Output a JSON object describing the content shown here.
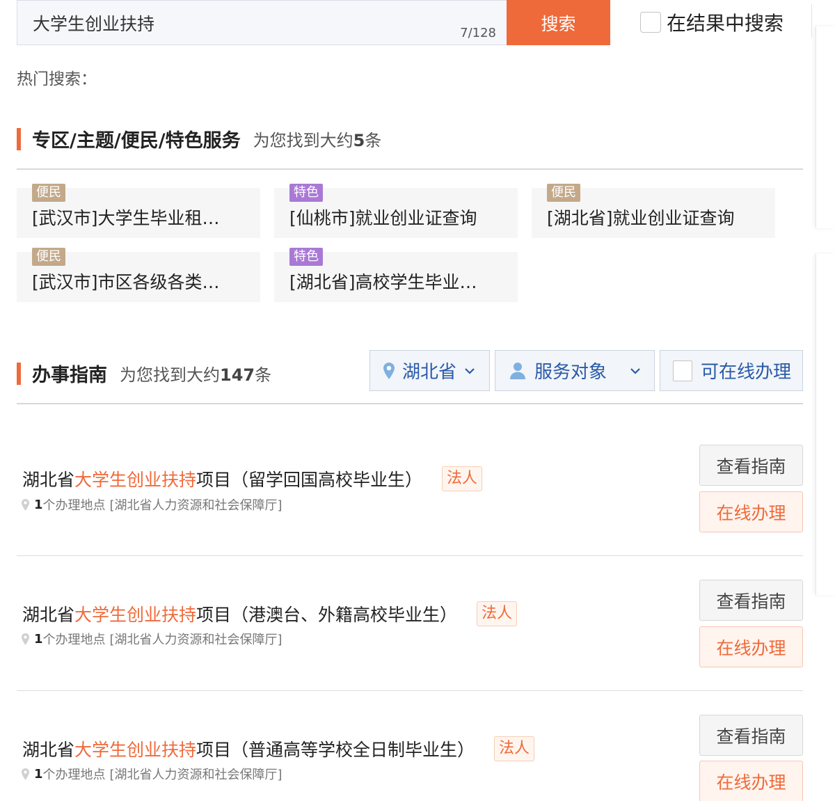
{
  "search": {
    "query": "大学生创业扶持",
    "count": "7/128",
    "button_label": "搜索",
    "in_results_label": "在结果中搜索"
  },
  "hot_search_label": "热门搜索：",
  "services_section": {
    "title": "专区/主题/便民/特色服务",
    "found_prefix": "为您找到大约",
    "found_count": "5",
    "found_suffix": "条",
    "items": [
      {
        "tag": "便民",
        "text": "[武汉市]大学生毕业租…"
      },
      {
        "tag": "特色",
        "text": "[仙桃市]就业创业证查询"
      },
      {
        "tag": "便民",
        "text": "[湖北省]就业创业证查询"
      },
      {
        "tag": "便民",
        "text": "[武汉市]市区各级各类…"
      },
      {
        "tag": "特色",
        "text": "[湖北省]高校学生毕业…"
      }
    ]
  },
  "guide_section": {
    "title": "办事指南",
    "found_prefix": "为您找到大约",
    "found_count": "147",
    "found_suffix": "条",
    "filters": {
      "region": "湖北省",
      "audience": "服务对象",
      "online_only": "可在线办理"
    },
    "results": [
      {
        "prefix": "湖北省",
        "highlight": "大学生创业扶持",
        "suffix": "项目（留学回国高校毕业生）",
        "badge": "法人",
        "count": "1",
        "location_label": "个办理地点",
        "dept": "[湖北省人力资源和社会保障厅]",
        "view_label": "查看指南",
        "online_label": "在线办理"
      },
      {
        "prefix": "湖北省",
        "highlight": "大学生创业扶持",
        "suffix": "项目（港澳台、外籍高校毕业生）",
        "badge": "法人",
        "count": "1",
        "location_label": "个办理地点",
        "dept": "[湖北省人力资源和社会保障厅]",
        "view_label": "查看指南",
        "online_label": "在线办理"
      },
      {
        "prefix": "湖北省",
        "highlight": "大学生创业扶持",
        "suffix": "项目（普通高等学校全日制毕业生）",
        "badge": "法人",
        "count": "1",
        "location_label": "个办理地点",
        "dept": "[湖北省人力资源和社会保障厅]",
        "view_label": "查看指南",
        "online_label": "在线办理"
      }
    ]
  },
  "colors": {
    "accent": "#ef6a3a",
    "tag_convenience": "#c3a98a",
    "tag_feature": "#a979d6",
    "link_blue": "#2a5aa8"
  }
}
